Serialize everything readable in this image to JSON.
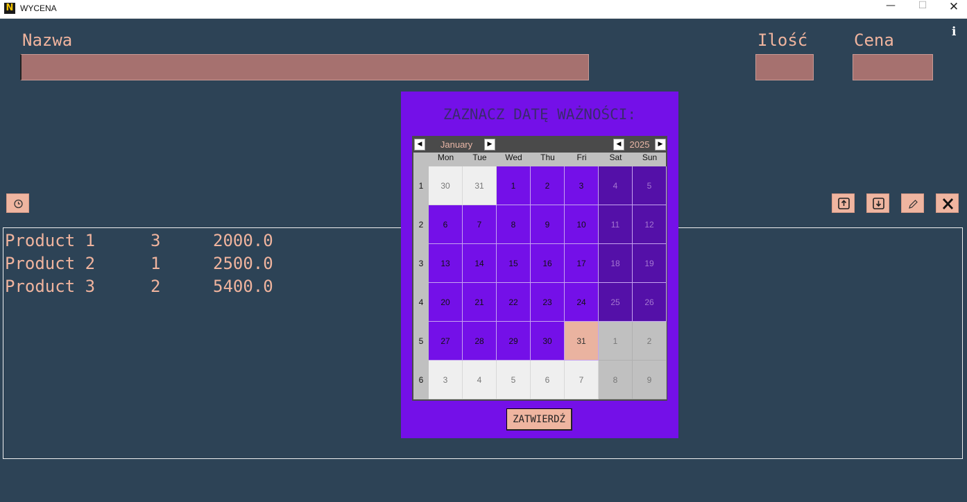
{
  "window": {
    "title": "WYCENA",
    "minimize": "—",
    "maximize": "☐",
    "close": "✕"
  },
  "form": {
    "name_label": "Nazwa",
    "qty_label": "Ilość",
    "price_label": "Cena",
    "name_value": "",
    "qty_value": "",
    "price_value": ""
  },
  "info_icon": "i",
  "toolbar": {
    "clock_icon": "clock-icon",
    "upload_icon": "upload-icon",
    "download_icon": "download-icon",
    "edit_icon": "pencil-icon",
    "delete_icon": "close-icon"
  },
  "products": [
    {
      "name": "Product 1",
      "qty": "3",
      "price": "2000.0"
    },
    {
      "name": "Product 2",
      "qty": "1",
      "price": "2500.0"
    },
    {
      "name": "Product 3",
      "qty": "2",
      "price": "5400.0"
    }
  ],
  "dialog": {
    "title": "ZAZNACZ DATĘ WAŻNOŚCI:",
    "month": "January",
    "year": "2025",
    "weekdays": [
      "Mon",
      "Tue",
      "Wed",
      "Thu",
      "Fri",
      "Sat",
      "Sun"
    ],
    "week_numbers": [
      "1",
      "2",
      "3",
      "4",
      "5",
      "6"
    ],
    "days": [
      [
        {
          "d": "30",
          "t": "oth"
        },
        {
          "d": "31",
          "t": "oth"
        },
        {
          "d": "1",
          "t": "wk"
        },
        {
          "d": "2",
          "t": "wk"
        },
        {
          "d": "3",
          "t": "wk"
        },
        {
          "d": "4",
          "t": "we"
        },
        {
          "d": "5",
          "t": "we"
        }
      ],
      [
        {
          "d": "6",
          "t": "wk"
        },
        {
          "d": "7",
          "t": "wk"
        },
        {
          "d": "8",
          "t": "wk"
        },
        {
          "d": "9",
          "t": "wk"
        },
        {
          "d": "10",
          "t": "wk"
        },
        {
          "d": "11",
          "t": "we"
        },
        {
          "d": "12",
          "t": "we"
        }
      ],
      [
        {
          "d": "13",
          "t": "wk"
        },
        {
          "d": "14",
          "t": "wk"
        },
        {
          "d": "15",
          "t": "wk"
        },
        {
          "d": "16",
          "t": "wk"
        },
        {
          "d": "17",
          "t": "wk"
        },
        {
          "d": "18",
          "t": "we"
        },
        {
          "d": "19",
          "t": "we"
        }
      ],
      [
        {
          "d": "20",
          "t": "wk"
        },
        {
          "d": "21",
          "t": "wk"
        },
        {
          "d": "22",
          "t": "wk"
        },
        {
          "d": "23",
          "t": "wk"
        },
        {
          "d": "24",
          "t": "wk"
        },
        {
          "d": "25",
          "t": "we"
        },
        {
          "d": "26",
          "t": "we"
        }
      ],
      [
        {
          "d": "27",
          "t": "wk"
        },
        {
          "d": "28",
          "t": "wk"
        },
        {
          "d": "29",
          "t": "wk"
        },
        {
          "d": "30",
          "t": "wk"
        },
        {
          "d": "31",
          "t": "sel"
        },
        {
          "d": "1",
          "t": "othwe"
        },
        {
          "d": "2",
          "t": "othwe"
        }
      ],
      [
        {
          "d": "3",
          "t": "oth"
        },
        {
          "d": "4",
          "t": "oth"
        },
        {
          "d": "5",
          "t": "oth"
        },
        {
          "d": "6",
          "t": "oth"
        },
        {
          "d": "7",
          "t": "oth"
        },
        {
          "d": "8",
          "t": "othwe"
        },
        {
          "d": "9",
          "t": "othwe"
        }
      ]
    ],
    "selected_date": "31",
    "confirm_label": "ZATWIERDŹ"
  },
  "colors": {
    "background": "#2d4356",
    "accent": "#efb5a0",
    "dialog": "#7410e8",
    "input": "#a6716f"
  }
}
